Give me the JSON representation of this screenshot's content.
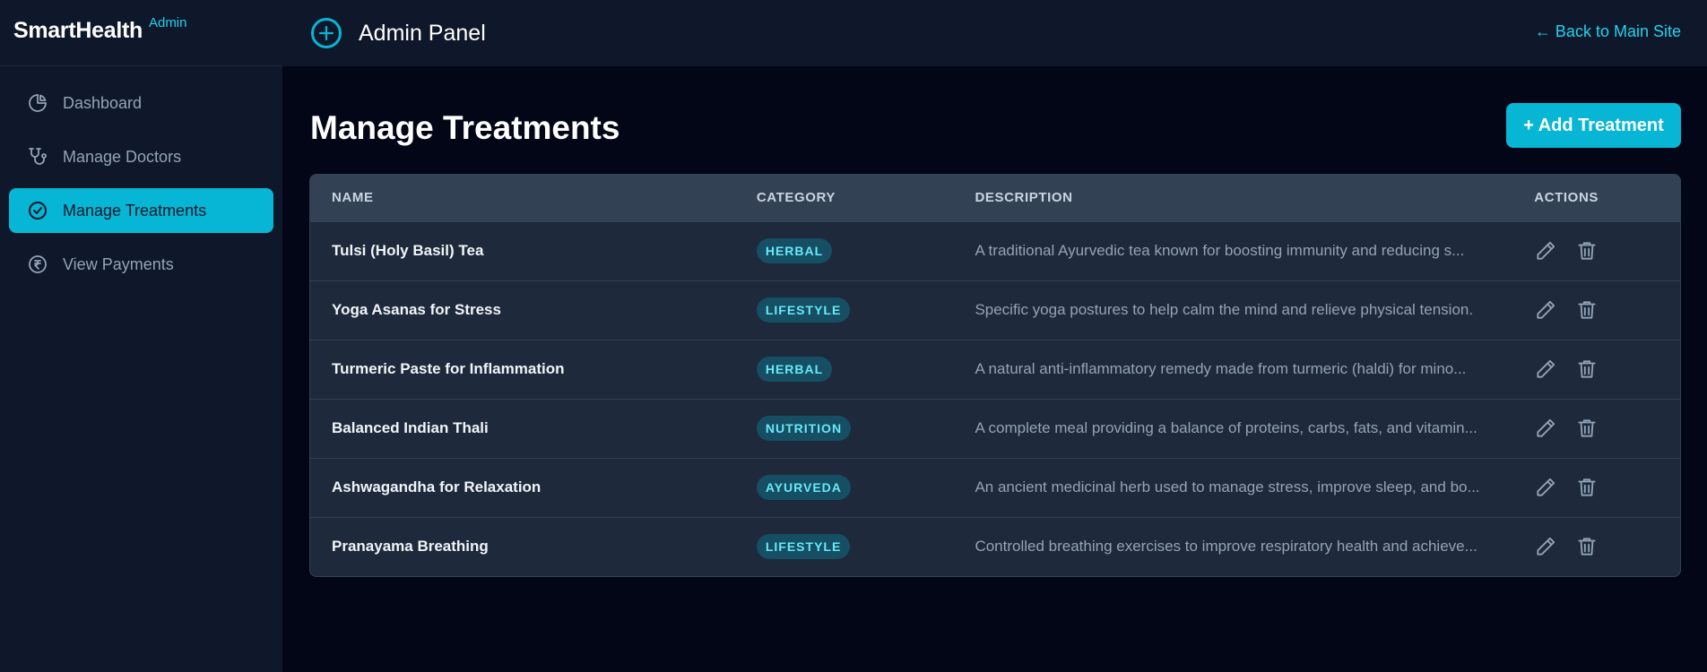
{
  "brand": {
    "name": "SmartHealth",
    "tag": "Admin"
  },
  "sidebar": {
    "items": [
      {
        "label": "Dashboard",
        "icon": "pie-chart-icon",
        "active": false
      },
      {
        "label": "Manage Doctors",
        "icon": "stethoscope-icon",
        "active": false
      },
      {
        "label": "Manage Treatments",
        "icon": "check-circle-icon",
        "active": true
      },
      {
        "label": "View Payments",
        "icon": "rupee-icon",
        "active": false
      }
    ]
  },
  "topbar": {
    "title": "Admin Panel",
    "back_link": "← Back to Main Site",
    "logo_icon": "plus-circle-icon"
  },
  "page": {
    "title": "Manage Treatments",
    "add_button": "+ Add Treatment"
  },
  "table": {
    "headers": {
      "name": "NAME",
      "category": "CATEGORY",
      "description": "DESCRIPTION",
      "actions": "ACTIONS"
    },
    "rows": [
      {
        "name": "Tulsi (Holy Basil) Tea",
        "category": "HERBAL",
        "description": "A traditional Ayurvedic tea known for boosting immunity and reducing s..."
      },
      {
        "name": "Yoga Asanas for Stress",
        "category": "LIFESTYLE",
        "description": "Specific yoga postures to help calm the mind and relieve physical tension."
      },
      {
        "name": "Turmeric Paste for Inflammation",
        "category": "HERBAL",
        "description": "A natural anti-inflammatory remedy made from turmeric (haldi) for mino..."
      },
      {
        "name": "Balanced Indian Thali",
        "category": "NUTRITION",
        "description": "A complete meal providing a balance of proteins, carbs, fats, and vitamin..."
      },
      {
        "name": "Ashwagandha for Relaxation",
        "category": "AYURVEDA",
        "description": "An ancient medicinal herb used to manage stress, improve sleep, and bo..."
      },
      {
        "name": "Pranayama Breathing",
        "category": "LIFESTYLE",
        "description": "Controlled breathing exercises to improve respiratory health and achieve..."
      }
    ]
  },
  "colors": {
    "accent": "#06b6d4",
    "accent_text": "#22d3ee",
    "sidebar_bg": "#0f172a",
    "page_bg": "#020617",
    "card_bg": "#1e293b",
    "header_bg": "#334155",
    "badge_bg": "#164e63",
    "badge_text": "#67e8f9"
  }
}
